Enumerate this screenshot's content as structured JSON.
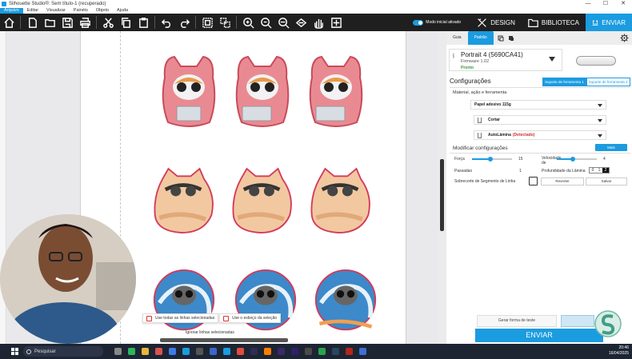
{
  "window": {
    "title": "Silhouette Studio®: Sem título-1 (recuperado)",
    "controls": [
      "—",
      "☐",
      "✕"
    ]
  },
  "menu": [
    "Arquivo",
    "Editar",
    "Visualizar",
    "Painéis",
    "Objeto",
    "Ajuda"
  ],
  "toolbar": {
    "icons": [
      "home-icon",
      "new-doc-icon",
      "open-icon",
      "save-icon",
      "print-icon",
      "cut-icon",
      "copy-icon",
      "paste-icon",
      "undo-icon",
      "redo-icon",
      "group-icon",
      "ungroup-icon",
      "zoom-in-icon",
      "zoom-out-icon",
      "zoom-fit-icon",
      "pan-hand-icon",
      "pan-move-icon"
    ],
    "mode_label": "Modo inicial ativado",
    "nav": {
      "design": "DESIGN",
      "library": "BIBLIOTECA",
      "send": "ENVIAR"
    }
  },
  "canvas": {
    "popups": {
      "use_all_lines": "Use todas as linhas selecionadas",
      "use_outline": "Use o esboço da seleção",
      "ignore_lines": "Ignorar linhas selecionadas"
    }
  },
  "panel": {
    "tabs": {
      "guide": "Guia",
      "standard": "Padrão"
    },
    "device": {
      "name": "Portrait 4 (5690CA41)",
      "firmware": "Firmware 1.02",
      "status": "Pronto"
    },
    "settings_title": "Configurações",
    "tool_tabs": [
      "Suporte de ferramenta 1",
      "Suporte de ferramenta 2"
    ],
    "material_section": "Material, ação e ferramenta",
    "material": "Papel adesivo 115g",
    "action": "Cortar",
    "tool_prefix": "AutoLâmina",
    "tool_status": "(Detectado)",
    "modify_title": "Modificar configurações",
    "more_btn": "Mais",
    "force_label": "Força",
    "force_value": "15",
    "speed_label": "Velocidade de",
    "speed_value": "4",
    "passes_label": "Passadas",
    "passes_value": "1",
    "depth_label": "Profundidade da Lâmina",
    "depth_cells": [
      "0",
      "1",
      "2"
    ],
    "overcut_label": "Sobrecorte de Segmento de Linha",
    "revert_btn": "Reverter",
    "save_btn": "Salvar",
    "test_btn": "Gerar forma de teste",
    "send_btn": "ENVIAR"
  },
  "taskbar": {
    "search": "Pesquisar",
    "time": "20:46",
    "date": "16/04/2025"
  },
  "colors": {
    "accent": "#1b9be0",
    "toolbar_bg": "#1f1f1f",
    "status_ok": "#3b9a3b",
    "warning": "#d62d2d"
  }
}
